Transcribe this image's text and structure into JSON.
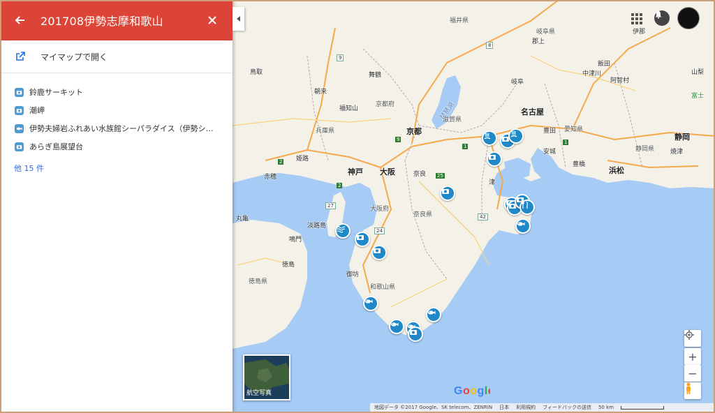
{
  "panel": {
    "title": "201708伊勢志摩和歌山",
    "open_label": "マイマップで開く",
    "items": [
      {
        "label": "鈴鹿サーキット",
        "icon": "camera-icon"
      },
      {
        "label": "潮岬",
        "icon": "camera-icon"
      },
      {
        "label": "伊勢夫婦岩ふれあい水族館シーパラダイス（伊勢シー…",
        "icon": "fish-icon"
      },
      {
        "label": "あらぎ島展望台",
        "icon": "camera-icon"
      }
    ],
    "more_label": "他 15 件"
  },
  "map": {
    "labels": {
      "fukui": "福井県",
      "gifu_pref": "岐阜県",
      "gujo": "郡上",
      "ina": "伊那",
      "iida": "飯田",
      "yamanashi": "山梨",
      "tottori": "鳥取",
      "maizuru": "舞鶴",
      "asago": "朝来",
      "fukuchiyama": "福知山",
      "kyoto_pref": "京都府",
      "biwa": "琵琶湖",
      "shiga": "滋賀県",
      "hyogo": "兵庫県",
      "kyoto": "京都",
      "gifu": "岐阜",
      "nakatsugawa": "中津川",
      "agiya": "阿智村",
      "fuji": "富士",
      "nagoya": "名古屋",
      "toyota": "豊田",
      "aichi": "愛知県",
      "anjo": "安城",
      "shizuoka_pref": "静岡県",
      "shizuoka": "静岡",
      "yaizu": "焼津",
      "himeji": "姫路",
      "kobe": "神戸",
      "osaka": "大阪",
      "nara": "奈良",
      "ako": "赤穂",
      "tsu": "津",
      "toyohashi": "豊橋",
      "hamamatsu": "浜松",
      "osaka_pref": "大阪府",
      "nara_pref": "奈良県",
      "awaji": "淡路島",
      "naruto": "鳴門",
      "tokushima": "徳島",
      "tokushima_pref": "徳島県",
      "gobo": "御坊",
      "wakayama_pref": "和歌山県",
      "marugame": "丸亀"
    },
    "road_numbers": [
      "9",
      "8",
      "1",
      "2",
      "2",
      "27",
      "9",
      "24",
      "25",
      "42",
      "1"
    ]
  },
  "controls": {
    "aerial_label": "航空写真",
    "zoom_in": "+",
    "zoom_out": "−"
  },
  "footer": {
    "data": "地図データ ©2017 Google、SK telecom、ZENRIN",
    "country": "日本",
    "terms": "利用規約",
    "feedback": "フィードバックの送信",
    "scale": "50 km"
  },
  "colors": {
    "header": "#db4437",
    "water": "#a6cbf5",
    "land": "#f4f1e8",
    "marker": "#1e88c9",
    "link": "#3367d6"
  }
}
